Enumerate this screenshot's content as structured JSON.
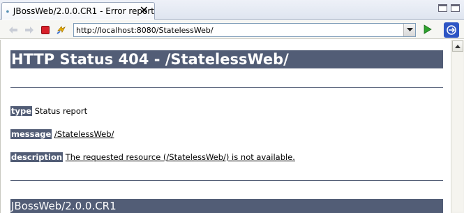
{
  "tab": {
    "title": "JBossWeb/2.0.0.CR1 - Error report",
    "close_glyph": "✕"
  },
  "toolbar": {
    "url": "http://localhost:8080/StatelessWeb/",
    "icons": [
      "back-arrow-icon",
      "forward-arrow-icon",
      "stop-icon",
      "refresh-icon",
      "url-dropdown-icon",
      "go-icon",
      "sidebar-icon"
    ]
  },
  "page": {
    "heading": "HTTP Status 404 - /StatelessWeb/",
    "type_label": "type",
    "type_value": "Status report",
    "message_label": "message",
    "message_value": "/StatelessWeb/",
    "description_label": "description",
    "description_value": "The requested resource (/StatelessWeb/) is not available.",
    "footer": "JBossWeb/2.0.0.CR1"
  },
  "colors": {
    "header_bg": "#525d76",
    "stop_red": "#d8202a",
    "go_green": "#2fa32f"
  }
}
